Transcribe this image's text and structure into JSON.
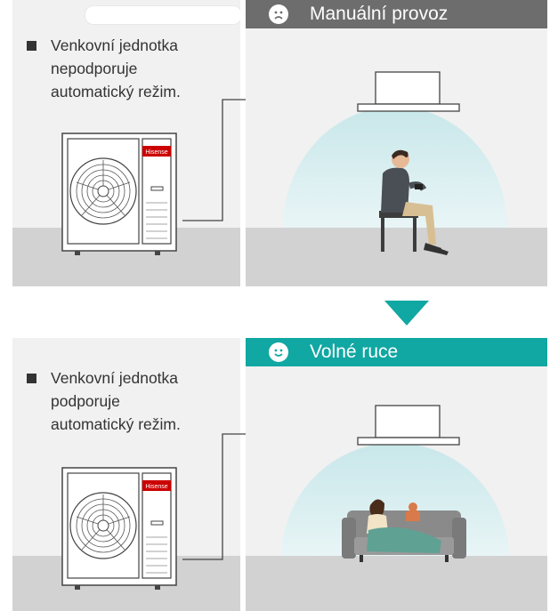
{
  "colors": {
    "panel_bg": "#f1f1f1",
    "floor": "#d2d2d2",
    "manual_header": "#6d6d6d",
    "auto_header": "#11a7a2",
    "arrow": "#11a7a2",
    "cool_glow": "#d7eef0"
  },
  "top_section": {
    "label_lines": [
      "Venkovní jednotka",
      "nepodporuje",
      "automatický režim."
    ],
    "mode_icon": "sad-face-icon",
    "mode_label": "Manuální provoz",
    "unit_brand": "Hisense"
  },
  "transition_icon": "down-triangle-arrow-icon",
  "bottom_section": {
    "label_lines": [
      "Venkovní jednotka",
      "podporuje",
      "automatický režim."
    ],
    "mode_icon": "happy-face-icon",
    "mode_label": "Volné ruce",
    "unit_brand": "Hisense"
  }
}
